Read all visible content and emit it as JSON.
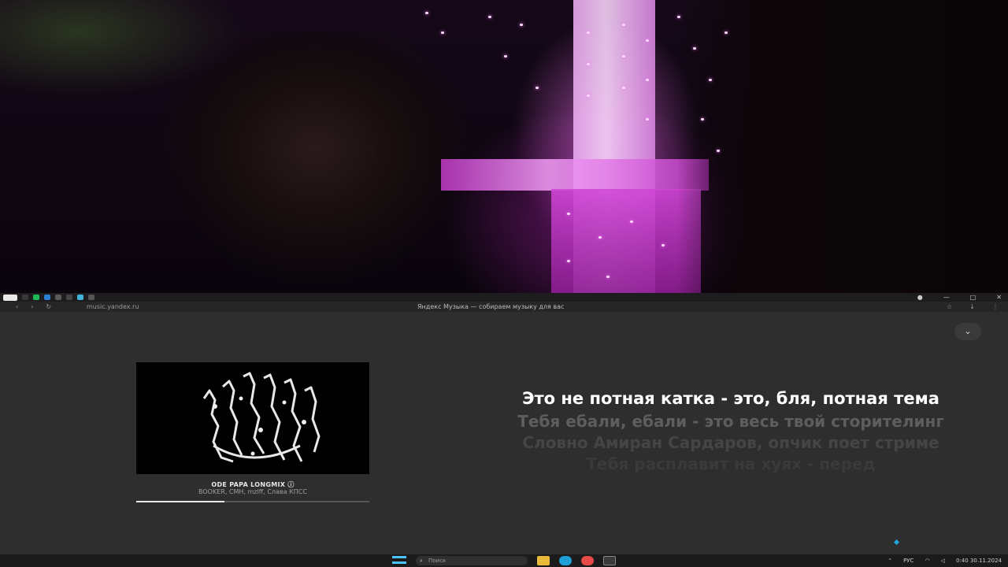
{
  "browser": {
    "url": "music.yandex.ru",
    "tab_title": "Яндекс Музыка — собираем музыку для вас"
  },
  "player": {
    "collapse_icon": "chevron-down-icon",
    "track": {
      "title": "ODE PAPA LONGMIX",
      "artists": "BOOKER, CMH, mzlff, Слава КПСС",
      "progress_fraction": 0.38
    },
    "lyrics": {
      "active": "Это не потная катка - это, бля, потная тема",
      "upcoming": [
        "Тебя ебали, ебали - это весь твой сторителинг",
        "Словно Амиран Сардаров, опчик поет стриме",
        "Тебя расплавит на хуях - перед"
      ]
    }
  },
  "taskbar": {
    "search_placeholder": "Поиск",
    "language": "РУС",
    "time": "0:40",
    "date": "30.11.2024"
  }
}
